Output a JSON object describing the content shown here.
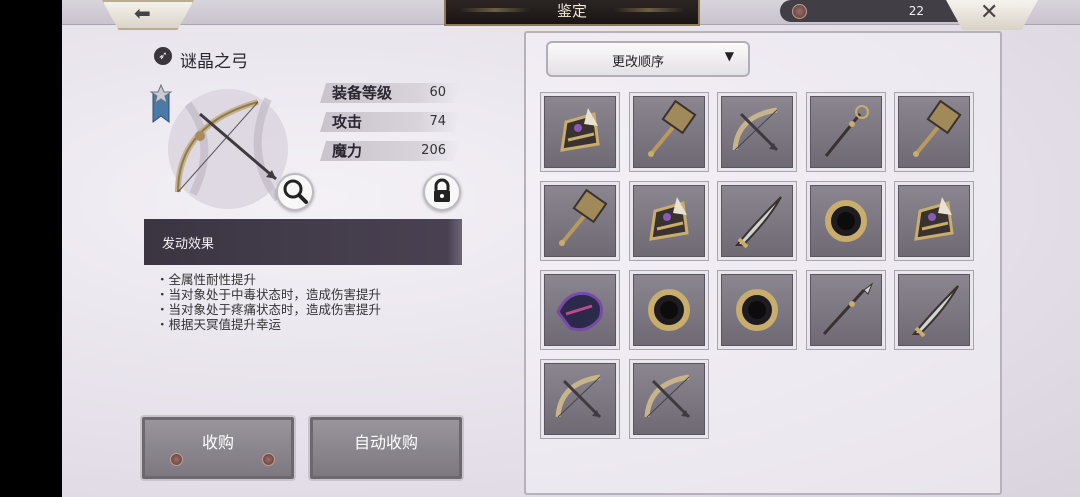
{
  "header": {
    "title": "鉴定",
    "currency_count": "22"
  },
  "item": {
    "name": "谜晶之弓",
    "stats": [
      {
        "label": "装备等级",
        "value": "60"
      },
      {
        "label": "攻击",
        "value": "74"
      },
      {
        "label": "魔力",
        "value": "206"
      }
    ],
    "effect_title": "发动效果",
    "effects": [
      "全属性耐性提升",
      "当对象处于中毒状态时，造成伤害提升",
      "当对象处于疼痛状态时，造成伤害提升",
      "根据天冥值提升幸运"
    ]
  },
  "actions": {
    "buy_label": "收购",
    "auto_buy_label": "自动收购"
  },
  "grid": {
    "sort_label": "更改顺序",
    "items": [
      "gauntlet-icon",
      "hammer-icon",
      "bow-icon",
      "staff-icon",
      "hammer-icon",
      "hammer-icon",
      "gauntlet-icon",
      "blade-icon",
      "ring-icon",
      "gauntlet-icon",
      "gem-icon",
      "ring-icon",
      "ring-icon",
      "spear-icon",
      "blade-icon",
      "bow-icon",
      "bow-icon"
    ]
  },
  "colors": {
    "accent": "#3b3542",
    "panel_bg": "#e6e1ea"
  }
}
